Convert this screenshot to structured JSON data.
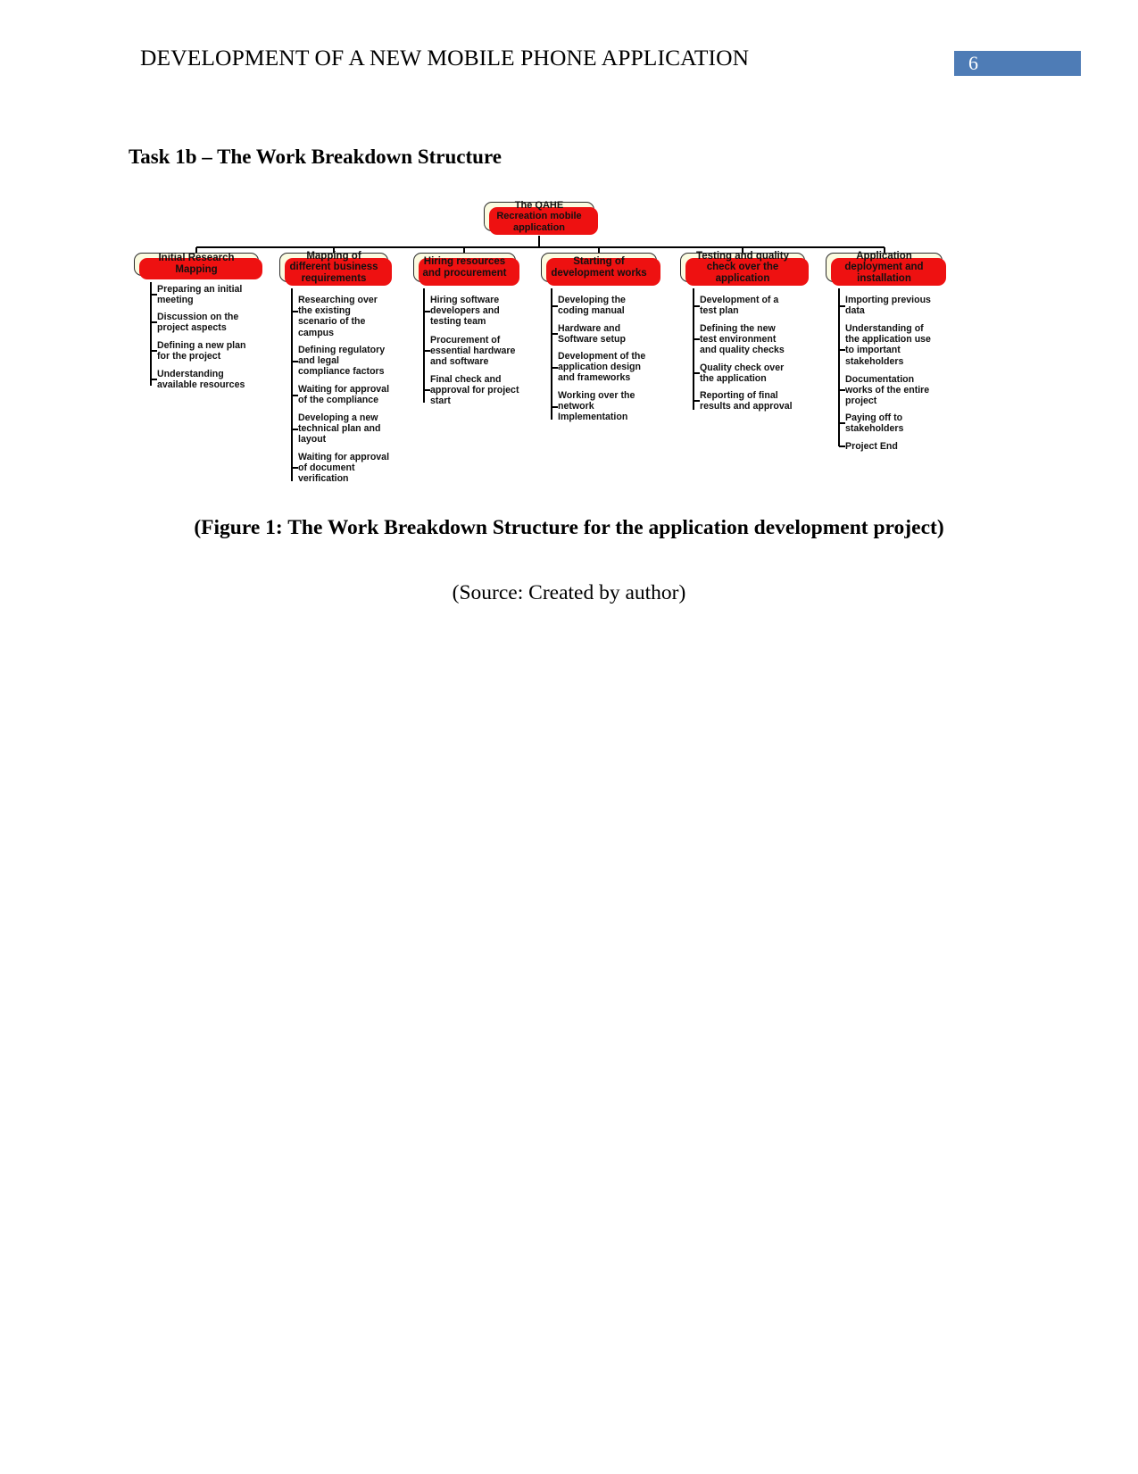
{
  "header": {
    "title": "DEVELOPMENT OF A NEW MOBILE PHONE APPLICATION",
    "page_number": "6",
    "badge_color": "#4e7cb6"
  },
  "section": {
    "heading": "Task 1b – The Work Breakdown Structure"
  },
  "figure": {
    "caption": "(Figure 1: The Work Breakdown Structure for the application development project)",
    "source": "(Source: Created by author)",
    "node_fill": "#fbfbe0",
    "node_shadow": "#ee1111",
    "node_border": "#2b2b2b"
  },
  "wbs": {
    "root": "The QAHE Recreation mobile application",
    "branches": [
      {
        "title": "Initial Research Mapping",
        "tasks": [
          "Preparing an initial meeting",
          "Discussion on the project aspects",
          "Defining a new plan for the project",
          "Understanding available resources"
        ]
      },
      {
        "title": "Mapping of different business requirements",
        "tasks": [
          "Researching over the existing scenario of the campus",
          "Defining regulatory and legal compliance factors",
          "Waiting for approval of the compliance",
          "Developing a new technical plan and layout",
          "Waiting for approval of document verification"
        ]
      },
      {
        "title": "Hiring resources and procurement",
        "tasks": [
          "Hiring software developers and testing team",
          "Procurement of essential hardware and software",
          "Final check and approval for project start"
        ]
      },
      {
        "title": "Starting of development works",
        "tasks": [
          "Developing the coding manual",
          "Hardware and Software setup",
          "Development of the application design and frameworks",
          "Working over the network Implementation"
        ]
      },
      {
        "title": "Testing and quality check over the application",
        "tasks": [
          "Development of a test plan",
          "Defining the new test environment and quality checks",
          "Quality check over the application",
          "Reporting of final results and approval"
        ]
      },
      {
        "title": "Application deployment and installation",
        "tasks": [
          "Importing previous data",
          "Understanding of the application use to important stakeholders",
          "Documentation works of the entire project",
          "Paying off to stakeholders",
          "Project End"
        ]
      }
    ]
  }
}
